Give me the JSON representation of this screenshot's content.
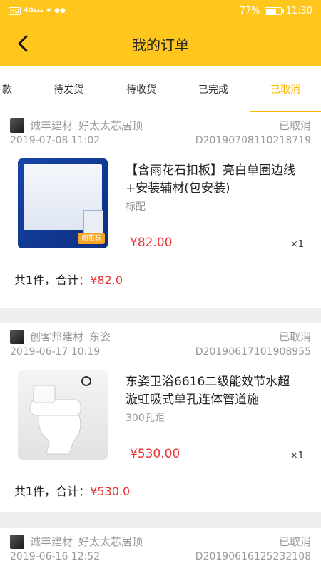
{
  "status_bar": {
    "left": "HD 4G ᛒ",
    "battery": "77%",
    "battery_level": 0.77,
    "time": "11:30"
  },
  "header": {
    "title": "我的订单"
  },
  "tabs": [
    {
      "label": "款",
      "active": false
    },
    {
      "label": "待发货",
      "active": false
    },
    {
      "label": "待收货",
      "active": false
    },
    {
      "label": "已完成",
      "active": false
    },
    {
      "label": "已取消",
      "active": true
    }
  ],
  "orders": [
    {
      "shop": "诚丰建材",
      "store": "好太太芯居顶",
      "status": "已取消",
      "date": "2019-07-08 11:02",
      "order_no": "D20190708110218719",
      "product_name": "【含雨花石扣板】亮白单圈边线+安装辅材(包安装)",
      "spec": "标配",
      "price": "¥82.00",
      "qty": "×1",
      "total_label": "共1件，合计：",
      "total_amount": "¥82.0",
      "thumb_badge": "雨花石"
    },
    {
      "shop": "创客邦建材",
      "store": "东姿",
      "status": "已取消",
      "date": "2019-06-17 10:19",
      "order_no": "D20190617101908955",
      "product_name": "东姿卫浴6616二级能效节水超漩虹吸式单孔连体管道施",
      "spec": "300孔距",
      "price": "¥530.00",
      "qty": "×1",
      "total_label": "共1件，合计：",
      "total_amount": "¥530.0",
      "thumb_badge": ""
    },
    {
      "shop": "诚丰建材",
      "store": "好太太芯居顶",
      "status": "已取消",
      "date": "2019-06-16 12:52",
      "order_no": "D20190616125232108"
    }
  ]
}
